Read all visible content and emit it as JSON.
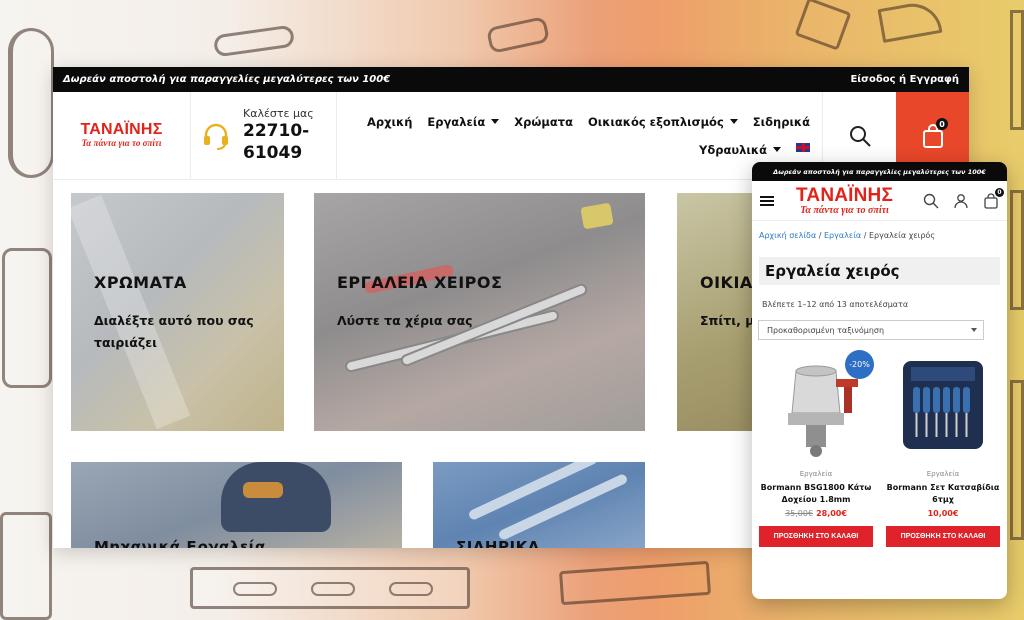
{
  "desktop": {
    "topbar": {
      "promo": "Δωρεάν αποστολή για παραγγελίες μεγαλύτερες των 100€",
      "login": "Είσοδος ή Εγγραφή"
    },
    "logo": {
      "title": "ΤΑΝΑΪΝΗΣ",
      "subtitle": "Τα πάντα για το σπίτι"
    },
    "phone": {
      "label": "Καλέστε μας",
      "number_line1": "22710-",
      "number_line2": "61049"
    },
    "nav": {
      "home": "Αρχική",
      "tools": "Εργαλεία",
      "paints": "Χρώματα",
      "household": "Οικιακός εξοπλισμός",
      "ironware": "Σιδηρικά",
      "plumbing": "Υδραυλικά"
    },
    "cart_count": "0",
    "tiles": {
      "paints": {
        "title": "ΧΡΩΜΑΤΑ",
        "subtitle_line1": "Διαλέξτε αυτό που σας",
        "subtitle_line2": "ταιριάζει"
      },
      "hand_tools": {
        "title": "ΕΡΓΑΛΕΙΑ ΧΕΙΡΟΣ",
        "subtitle": "Λύστε τα χέρια σας"
      },
      "third": {
        "title": "ΟΙΚΙΑ",
        "subtitle": "Σπίτι, μ"
      },
      "workwear": {
        "title": "Μηχανικά Εργαλεία"
      },
      "ironware": {
        "title": "ΣΙΔΗΡΙΚΑ"
      }
    }
  },
  "mobile": {
    "topbar": {
      "promo": "Δωρεάν αποστολή για παραγγελίες μεγαλύτερες των 100€"
    },
    "logo": {
      "title": "ΤΑΝΑΪΝΗΣ",
      "subtitle": "Τα πάντα για το σπίτι"
    },
    "cart_count": "0",
    "breadcrumb": {
      "home": "Αρχική σελίδα",
      "sep": " / ",
      "tools": "Εργαλεία",
      "current": "Εργαλεία χειρός"
    },
    "page_title": "Εργαλεία χειρός",
    "result_count": "Βλέπετε 1–12 από 13 αποτελέσματα",
    "sort_select": "Προκαθορισμένη ταξινόμηση",
    "products": [
      {
        "badge": "-20%",
        "category": "Εργαλεία",
        "name_line1": "Bormann BSG1800 Κάτω",
        "name_line2": "Δοχείου 1.8mm",
        "old_price": "35,00€",
        "price": "28,00€",
        "button": "ΠΡΟΣΘΗΚΗ ΣΤΟ ΚΑΛΑΘΙ"
      },
      {
        "category": "Εργαλεία",
        "name_line1": "Bormann Σετ Κατσαβίδια",
        "name_line2": "6τμχ",
        "price": "10,00€",
        "button": "ΠΡΟΣΘΗΚΗ ΣΤΟ ΚΑΛΑΘΙ"
      }
    ]
  },
  "colors": {
    "brand_red": "#e2231a",
    "cart_orange": "#e8472a",
    "headset_yellow": "#e9b11e",
    "link_blue": "#2d7ac3",
    "sale_blue": "#2c6fc4"
  },
  "icons": [
    "headset-icon",
    "search-icon",
    "shopping-bag-icon",
    "caret-down-icon",
    "uk-flag-icon",
    "hamburger-icon",
    "user-icon"
  ]
}
